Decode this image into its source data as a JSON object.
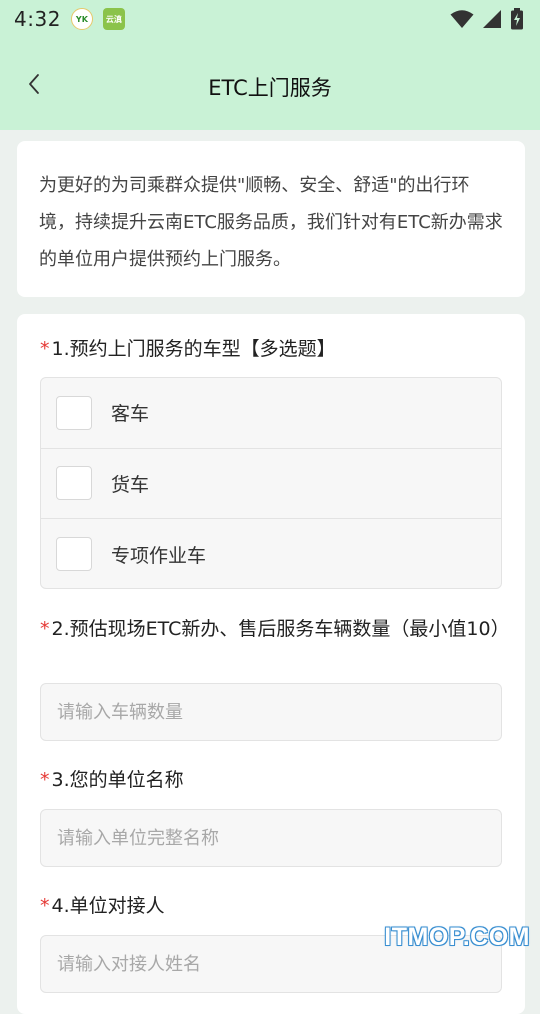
{
  "status_bar": {
    "time": "4:32",
    "notif_1": "YK",
    "notif_2": "云滇",
    "icons": [
      "wifi-icon",
      "signal-icon",
      "battery-icon"
    ]
  },
  "header": {
    "title": "ETC上门服务",
    "back_icon": "chevron-left-icon"
  },
  "intro": {
    "text": "为更好的为司乘群众提供\"顺畅、安全、舒适\"的出行环境，持续提升云南ETC服务品质，我们针对有ETC新办需求的单位用户提供预约上门服务。"
  },
  "form": {
    "required_mark": "*",
    "q1": {
      "label": "1.预约上门服务的车型【多选题】",
      "options": [
        "客车",
        "货车",
        "专项作业车"
      ]
    },
    "q2": {
      "label": "2.预估现场ETC新办、售后服务车辆数量（最小值10）",
      "placeholder": "请输入车辆数量"
    },
    "q3": {
      "label": "3.您的单位名称",
      "placeholder": "请输入单位完整名称"
    },
    "q4": {
      "label": "4.单位对接人",
      "placeholder": "请输入对接人姓名"
    }
  },
  "watermark": "ITMOP.COM",
  "colors": {
    "header_bg": "#c9f2d6",
    "page_bg": "#ecf1ee",
    "required": "#e53935"
  }
}
